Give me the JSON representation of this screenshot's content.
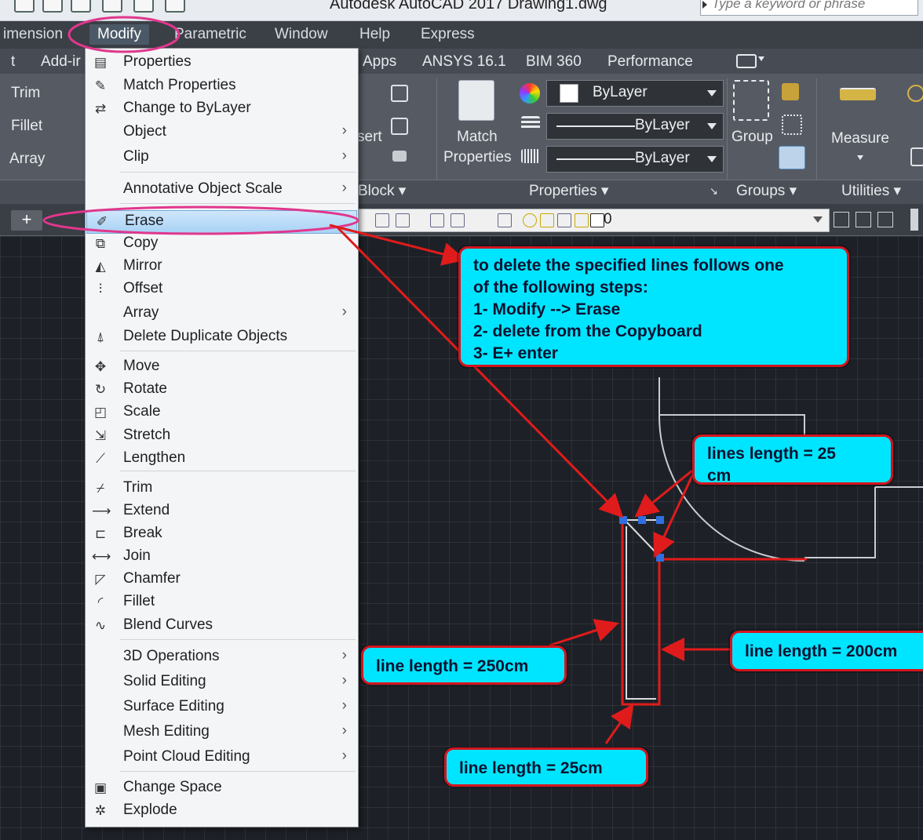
{
  "titlebar": {
    "title": "Autodesk AutoCAD 2017     Drawing1.dwg",
    "search_placeholder": "Type a keyword or phrase"
  },
  "menubar": {
    "items": [
      "imension",
      "Modify",
      "Parametric",
      "Window",
      "Help",
      "Express"
    ]
  },
  "ribbon_tabs": {
    "items": [
      "t",
      "Add-ir",
      "Apps",
      "ANSYS 16.1",
      "BIM 360",
      "Performance"
    ]
  },
  "ribbon": {
    "left_tools": [
      "Trim",
      "Fillet",
      "Array"
    ],
    "insert_label": "sert",
    "match_properties": [
      "Match",
      "Properties"
    ],
    "color_value": "ByLayer",
    "linetype_value": "ByLayer",
    "lineweight_value": "ByLayer",
    "group_label": "Group",
    "measure_label": "Measure",
    "panels": [
      "Block",
      "Properties",
      "Groups",
      "Utilities"
    ]
  },
  "toolbar": {
    "plus": "+",
    "layer_value": "0"
  },
  "modify_menu": {
    "items": [
      {
        "label": "Properties",
        "icon": "properties-icon",
        "sub": false
      },
      {
        "label": "Match Properties",
        "icon": "match-properties-icon",
        "sub": false
      },
      {
        "label": "Change to ByLayer",
        "icon": "change-bylayer-icon",
        "sub": false
      },
      {
        "label": "Object",
        "icon": "",
        "sub": true
      },
      {
        "label": "Clip",
        "icon": "",
        "sub": true
      },
      {
        "label": "Annotative Object Scale",
        "icon": "",
        "sub": true
      },
      {
        "label": "Erase",
        "icon": "erase-icon",
        "sub": false
      },
      {
        "label": "Copy",
        "icon": "copy-icon",
        "sub": false
      },
      {
        "label": "Mirror",
        "icon": "mirror-icon",
        "sub": false
      },
      {
        "label": "Offset",
        "icon": "offset-icon",
        "sub": false
      },
      {
        "label": "Array",
        "icon": "",
        "sub": true
      },
      {
        "label": "Delete Duplicate Objects",
        "icon": "delete-duplicate-icon",
        "sub": false
      },
      {
        "label": "Move",
        "icon": "move-icon",
        "sub": false
      },
      {
        "label": "Rotate",
        "icon": "rotate-icon",
        "sub": false
      },
      {
        "label": "Scale",
        "icon": "scale-icon",
        "sub": false
      },
      {
        "label": "Stretch",
        "icon": "stretch-icon",
        "sub": false
      },
      {
        "label": "Lengthen",
        "icon": "lengthen-icon",
        "sub": false
      },
      {
        "label": "Trim",
        "icon": "trim-icon",
        "sub": false
      },
      {
        "label": "Extend",
        "icon": "extend-icon",
        "sub": false
      },
      {
        "label": "Break",
        "icon": "break-icon",
        "sub": false
      },
      {
        "label": "Join",
        "icon": "join-icon",
        "sub": false
      },
      {
        "label": "Chamfer",
        "icon": "chamfer-icon",
        "sub": false
      },
      {
        "label": "Fillet",
        "icon": "fillet-icon",
        "sub": false
      },
      {
        "label": "Blend Curves",
        "icon": "blend-curves-icon",
        "sub": false
      },
      {
        "label": "3D Operations",
        "icon": "",
        "sub": true
      },
      {
        "label": "Solid Editing",
        "icon": "",
        "sub": true
      },
      {
        "label": "Surface Editing",
        "icon": "",
        "sub": true
      },
      {
        "label": "Mesh Editing",
        "icon": "",
        "sub": true
      },
      {
        "label": "Point Cloud Editing",
        "icon": "",
        "sub": true
      },
      {
        "label": "Change Space",
        "icon": "change-space-icon",
        "sub": false
      },
      {
        "label": "Explode",
        "icon": "explode-icon",
        "sub": false
      }
    ]
  },
  "callouts": {
    "steps": [
      "to delete the specified lines follows one",
      "of the following steps:",
      "1- Modify --> Erase",
      "2- delete from the Copyboard",
      "3- E+ enter"
    ],
    "lines25_a": "lines length = 25",
    "lines25_b": "cm",
    "line250": "line length = 250cm",
    "line200": "line length = 200cm",
    "line25": "line length = 25cm"
  },
  "colors": {
    "callout_fill": "#00e5ff",
    "callout_border": "#d4141e",
    "highlight_ring": "#e0378d",
    "arrow": "#e01b1b"
  }
}
